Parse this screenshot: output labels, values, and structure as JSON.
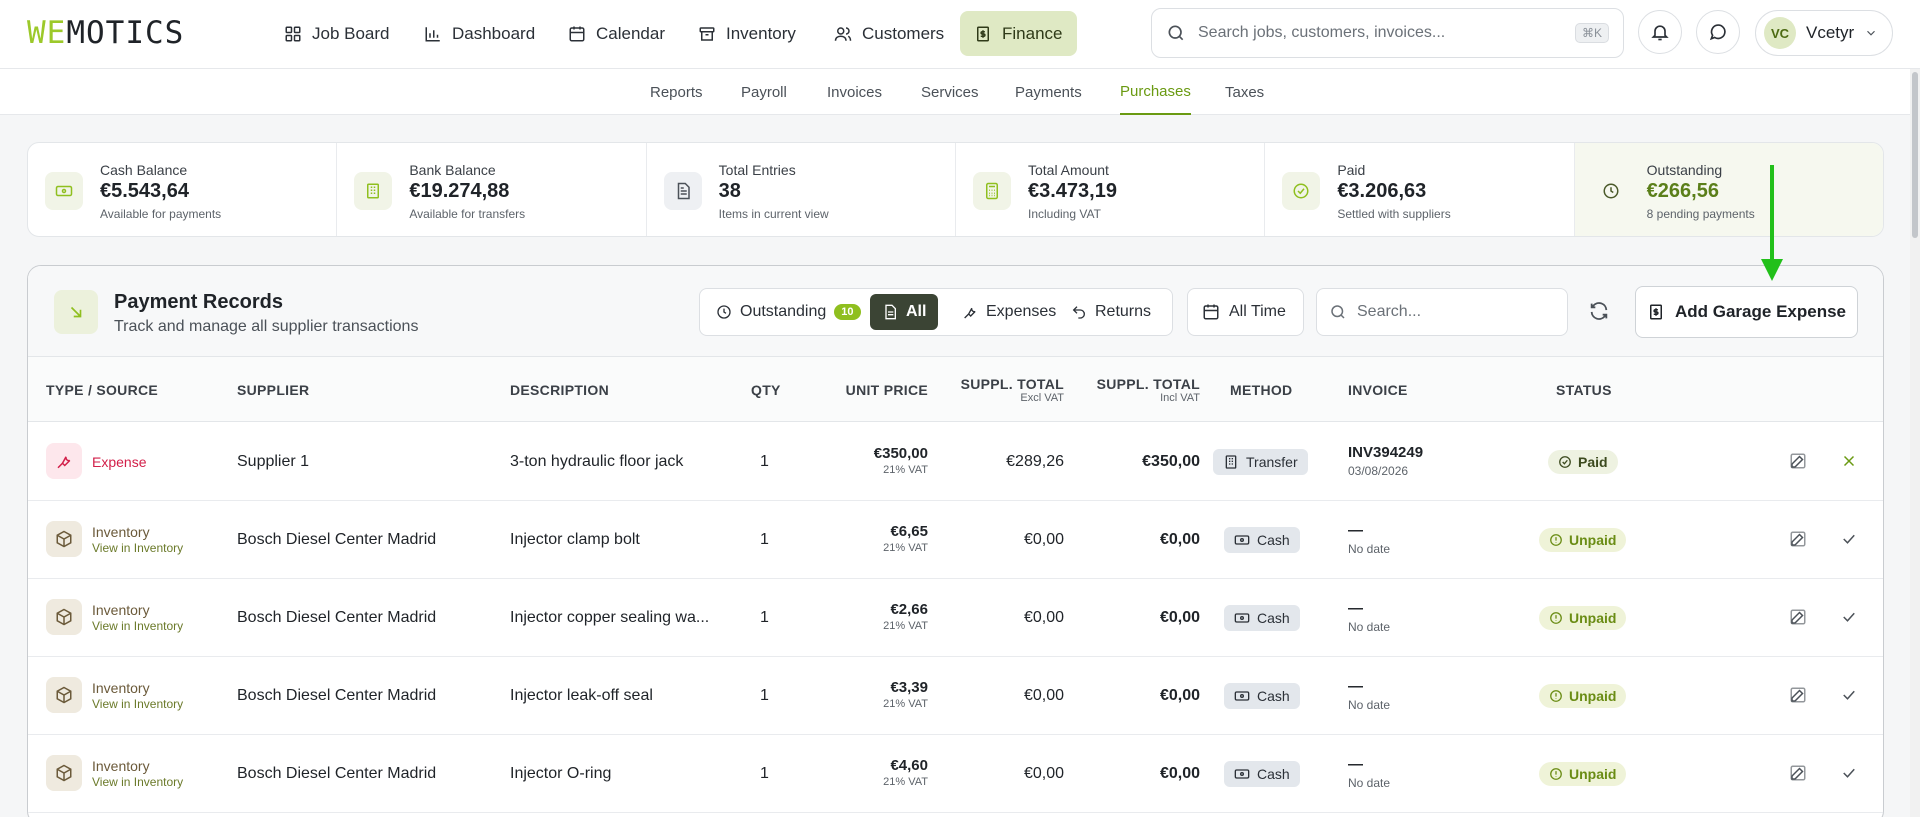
{
  "brand": {
    "logo_we": "WE",
    "logo_rest": "MOTICS"
  },
  "nav": {
    "items": [
      {
        "label": "Job Board",
        "icon": "grid-icon"
      },
      {
        "label": "Dashboard",
        "icon": "bar-chart-icon"
      },
      {
        "label": "Calendar",
        "icon": "calendar-icon"
      },
      {
        "label": "Inventory",
        "icon": "archive-icon"
      },
      {
        "label": "Customers",
        "icon": "users-icon"
      },
      {
        "label": "Finance",
        "icon": "receipt-icon",
        "active": true
      }
    ]
  },
  "search": {
    "placeholder": "Search jobs, customers, invoices...",
    "shortcut": "⌘K"
  },
  "user": {
    "initials": "VC",
    "name": "Vcetyr"
  },
  "subnav": {
    "tabs": [
      {
        "label": "Reports"
      },
      {
        "label": "Payroll"
      },
      {
        "label": "Invoices"
      },
      {
        "label": "Services"
      },
      {
        "label": "Payments"
      },
      {
        "label": "Purchases",
        "active": true
      },
      {
        "label": "Taxes"
      }
    ]
  },
  "stats": [
    {
      "label": "Cash Balance",
      "value": "€5.543,64",
      "sub": "Available for payments",
      "icon": "banknote-icon"
    },
    {
      "label": "Bank Balance",
      "value": "€19.274,88",
      "sub": "Available for transfers",
      "icon": "bank-icon"
    },
    {
      "label": "Total Entries",
      "value": "38",
      "sub": "Items in current view",
      "icon": "document-icon"
    },
    {
      "label": "Total Amount",
      "value": "€3.473,19",
      "sub": "Including VAT",
      "icon": "calculator-icon"
    },
    {
      "label": "Paid",
      "value": "€3.206,63",
      "sub": "Settled with suppliers",
      "icon": "check-circle-icon"
    },
    {
      "label": "Outstanding",
      "value": "€266,56",
      "sub": "8 pending payments",
      "icon": "clock-icon"
    }
  ],
  "card": {
    "title": "Payment Records",
    "subtitle": "Track and manage all supplier transactions",
    "filters": {
      "outstanding": "Outstanding",
      "outstanding_count": "10",
      "all": "All",
      "expenses": "Expenses",
      "returns": "Returns"
    },
    "time": "All Time",
    "search_placeholder": "Search...",
    "add_button": "Add Garage Expense"
  },
  "table": {
    "headers": {
      "type": "TYPE / SOURCE",
      "supplier": "SUPPLIER",
      "description": "DESCRIPTION",
      "qty": "QTY",
      "unit_price": "UNIT PRICE",
      "total_excl": "SUPPL. TOTAL",
      "total_excl_sub": "Excl VAT",
      "total_incl": "SUPPL. TOTAL",
      "total_incl_sub": "Incl VAT",
      "method": "METHOD",
      "invoice": "INVOICE",
      "status": "STATUS"
    },
    "rows": [
      {
        "kind": "expense",
        "type": "Expense",
        "link": "",
        "supplier": "Supplier 1",
        "description": "3-ton hydraulic floor jack",
        "qty": "1",
        "unit_price": "€350,00",
        "vat": "21% VAT",
        "total_excl": "€289,26",
        "total_incl": "€350,00",
        "method": "Transfer",
        "invoice": "INV394249",
        "invoice_date": "03/08/2026",
        "status": "Paid"
      },
      {
        "kind": "inventory",
        "type": "Inventory",
        "link": "View in Inventory",
        "supplier": "Bosch Diesel Center Madrid",
        "description": "Injector clamp bolt",
        "qty": "1",
        "unit_price": "€6,65",
        "vat": "21% VAT",
        "total_excl": "€0,00",
        "total_incl": "€0,00",
        "method": "Cash",
        "invoice": "—",
        "invoice_date": "No date",
        "status": "Unpaid"
      },
      {
        "kind": "inventory",
        "type": "Inventory",
        "link": "View in Inventory",
        "supplier": "Bosch Diesel Center Madrid",
        "description": "Injector copper sealing wa...",
        "qty": "1",
        "unit_price": "€2,66",
        "vat": "21% VAT",
        "total_excl": "€0,00",
        "total_incl": "€0,00",
        "method": "Cash",
        "invoice": "—",
        "invoice_date": "No date",
        "status": "Unpaid"
      },
      {
        "kind": "inventory",
        "type": "Inventory",
        "link": "View in Inventory",
        "supplier": "Bosch Diesel Center Madrid",
        "description": "Injector leak-off seal",
        "qty": "1",
        "unit_price": "€3,39",
        "vat": "21% VAT",
        "total_excl": "€0,00",
        "total_incl": "€0,00",
        "method": "Cash",
        "invoice": "—",
        "invoice_date": "No date",
        "status": "Unpaid"
      },
      {
        "kind": "inventory",
        "type": "Inventory",
        "link": "View in Inventory",
        "supplier": "Bosch Diesel Center Madrid",
        "description": "Injector O-ring",
        "qty": "1",
        "unit_price": "€4,60",
        "vat": "21% VAT",
        "total_excl": "€0,00",
        "total_incl": "€0,00",
        "method": "Cash",
        "invoice": "—",
        "invoice_date": "No date",
        "status": "Unpaid"
      }
    ]
  },
  "colors": {
    "accent": "#8fbf1f",
    "expense": "#d21f49",
    "annotation_arrow": "#22c01a"
  }
}
